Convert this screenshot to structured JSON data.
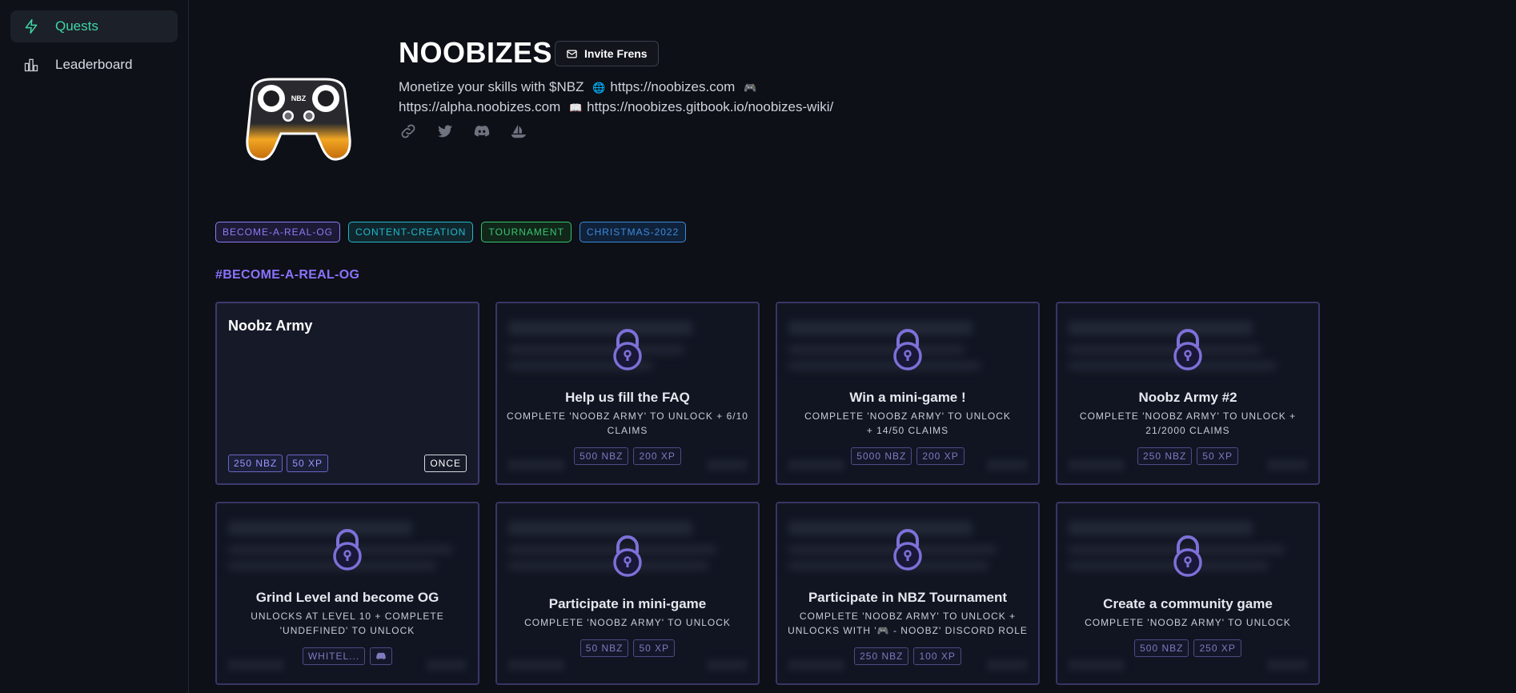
{
  "sidebar": {
    "items": [
      {
        "label": "Quests",
        "icon": "lightning-icon",
        "active": true
      },
      {
        "label": "Leaderboard",
        "icon": "bar-chart-icon",
        "active": false
      }
    ]
  },
  "header": {
    "title": "NOOBIZES",
    "invite_label": "Invite Frens",
    "desc_part1": "Monetize your skills with $NBZ",
    "url1": "https://noobizes.com",
    "url2": "https://alpha.noobizes.com",
    "url3": "https://noobizes.gitbook.io/noobizes-wiki/",
    "logo_text": "NBZ"
  },
  "tags": [
    {
      "label": "BECOME-A-REAL-OG",
      "color": "#8b7cf6"
    },
    {
      "label": "CONTENT-CREATION",
      "color": "#22b8cf"
    },
    {
      "label": "TOURNAMENT",
      "color": "#3bc470"
    },
    {
      "label": "CHRISTMAS-2022",
      "color": "#3b8bdb"
    }
  ],
  "section": {
    "title": "#BECOME-A-REAL-OG"
  },
  "cards": [
    {
      "title": "Noobz Army",
      "open": true,
      "badges": [
        "250 NBZ",
        "50 XP"
      ],
      "once": "ONCE"
    },
    {
      "title": "Help us fill the FAQ",
      "sub": "COMPLETE 'NOOBZ ARMY' TO UNLOCK + 6/10 CLAIMS",
      "badges": [
        "500 NBZ",
        "200 XP"
      ]
    },
    {
      "title": "Win a mini-game !",
      "sub": "COMPLETE 'NOOBZ ARMY' TO UNLOCK + 14/50 CLAIMS",
      "badges": [
        "5000 NBZ",
        "200 XP"
      ]
    },
    {
      "title": "Noobz Army #2",
      "sub": "COMPLETE 'NOOBZ ARMY' TO UNLOCK + 21/2000 CLAIMS",
      "badges": [
        "250 NBZ",
        "50 XP"
      ]
    },
    {
      "title": "Grind Level and become OG",
      "sub": "UNLOCKS AT LEVEL 10 + COMPLETE 'UNDEFINED' TO UNLOCK",
      "badges": [
        "WHITEL..."
      ]
    },
    {
      "title": "Participate in mini-game",
      "sub": "COMPLETE 'NOOBZ ARMY' TO UNLOCK",
      "badges": [
        "50 NBZ",
        "50 XP"
      ]
    },
    {
      "title": "Participate in NBZ Tournament",
      "sub": "COMPLETE 'NOOBZ ARMY' TO UNLOCK + UNLOCKS WITH '🎮 - NOOBZ' DISCORD ROLE",
      "badges": [
        "250 NBZ",
        "100 XP"
      ]
    },
    {
      "title": "Create a community game",
      "sub": "COMPLETE 'NOOBZ ARMY' TO UNLOCK",
      "badges": [
        "500 NBZ",
        "250 XP"
      ]
    }
  ]
}
